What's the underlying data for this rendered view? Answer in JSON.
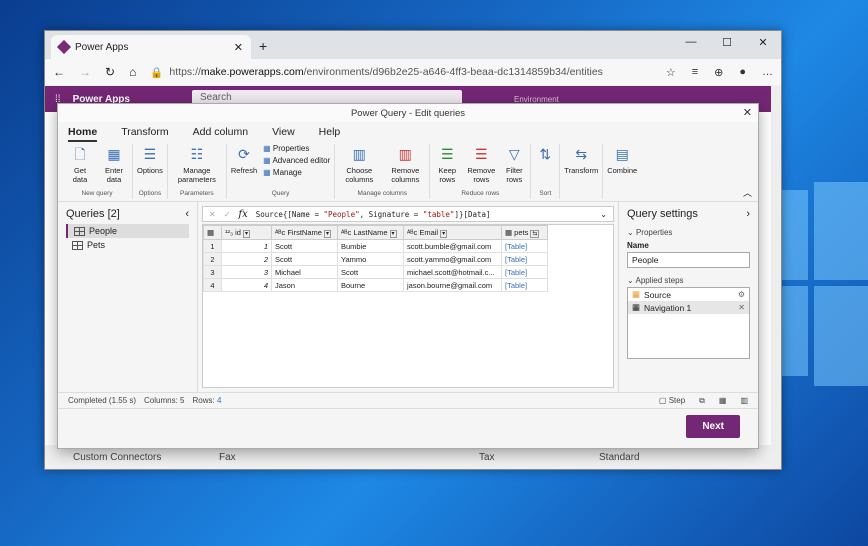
{
  "browser": {
    "tab_title": "Power Apps",
    "url_prefix": "https://",
    "url_host": "make.powerapps.com",
    "url_path": "/environments/d96b2e25-a646-4ff3-beaa-dc1314859b34/entities"
  },
  "app": {
    "name": "Power Apps",
    "search_placeholder": "Search",
    "environment_label": "Environment",
    "footer_item": "Custom Connectors",
    "footer_cols": [
      "Fax",
      "Tax",
      "Standard"
    ]
  },
  "dialog": {
    "title": "Power Query - Edit queries",
    "tabs": [
      "Home",
      "Transform",
      "Add column",
      "View",
      "Help"
    ],
    "ribbon": {
      "get_data": "Get data",
      "enter_data": "Enter data",
      "new_query_group": "New query",
      "options": "Options",
      "options_group": "Options",
      "manage_parameters": "Manage parameters",
      "parameters_group": "Parameters",
      "refresh": "Refresh",
      "properties": "Properties",
      "advanced_editor": "Advanced editor",
      "manage": "Manage",
      "query_group": "Query",
      "choose_columns": "Choose columns",
      "remove_columns": "Remove columns",
      "manage_columns_group": "Manage columns",
      "keep_rows": "Keep rows",
      "remove_rows": "Remove rows",
      "filter_rows": "Filter rows",
      "reduce_rows_group": "Reduce rows",
      "sort_group": "Sort",
      "transform": "Transform",
      "combine": "Combine"
    },
    "queries": {
      "header": "Queries [2]",
      "items": [
        "People",
        "Pets"
      ]
    },
    "formula": "Source{[Name = \"People\", Signature = \"table\"]}[Data]",
    "formula_parts": {
      "a": "Source{[Name = ",
      "b": "\"People\"",
      "c": ", Signature = ",
      "d": "\"table\"",
      "e": "]}[Data]"
    },
    "grid": {
      "columns": [
        "id",
        "FirstName",
        "LastName",
        "Email",
        "pets"
      ],
      "rows": [
        {
          "n": "1",
          "id": "1",
          "first": "Scott",
          "last": "Bumbie",
          "email": "scott.bumble@gmail.com",
          "pets": "[Table]"
        },
        {
          "n": "2",
          "id": "2",
          "first": "Scott",
          "last": "Yammo",
          "email": "scott.yammo@gmail.com",
          "pets": "[Table]"
        },
        {
          "n": "3",
          "id": "3",
          "first": "Michael",
          "last": "Scott",
          "email": "michael.scott@hotmail.c...",
          "pets": "[Table]"
        },
        {
          "n": "4",
          "id": "4",
          "first": "Jason",
          "last": "Bourne",
          "email": "jason.bourne@gmail.com",
          "pets": "[Table]"
        }
      ]
    },
    "settings": {
      "header": "Query settings",
      "properties": "Properties",
      "name_label": "Name",
      "name_value": "People",
      "applied_steps": "Applied steps",
      "steps": [
        "Source",
        "Navigation 1"
      ]
    },
    "status": {
      "completed": "Completed (1.55 s)",
      "columns": "Columns: 5",
      "rows_label": "Rows:",
      "rows_value": "4",
      "step": "Step"
    },
    "next": "Next"
  }
}
